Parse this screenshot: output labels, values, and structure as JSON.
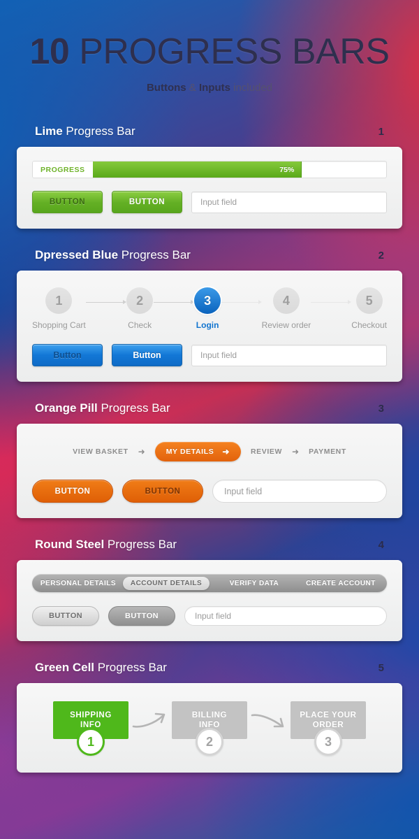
{
  "hero": {
    "title_number": "10",
    "title_rest": " PROGRESS BARS",
    "sub_bold1": "Buttons",
    "sub_amp": " & ",
    "sub_bold2": "Inputs",
    "sub_tail": " included"
  },
  "colors": {
    "lime": "#64b025",
    "blue": "#1277d6",
    "orange": "#e2620c",
    "steel": "#9a9a9a",
    "green": "#4fb81b",
    "card_bg": "#f0f0f0",
    "heading": "#ffffff",
    "number": "#2b2b4a"
  },
  "common": {
    "input_placeholder": "Input field"
  },
  "sections": [
    {
      "name_bold": "Lime",
      "name_rest": " Progress Bar",
      "number": "1",
      "progress": {
        "label": "PROGRESS",
        "value_label": "75%",
        "percent": 75
      },
      "buttons": [
        {
          "label": "BUTTON",
          "style": "dark"
        },
        {
          "label": "BUTTON",
          "style": "light"
        }
      ]
    },
    {
      "name_bold": "Dpressed Blue",
      "name_rest": " Progress Bar",
      "number": "2",
      "steps": [
        {
          "num": "1",
          "label": "Shopping Cart",
          "active": false
        },
        {
          "num": "2",
          "label": "Check",
          "active": false
        },
        {
          "num": "3",
          "label": "Login",
          "active": true
        },
        {
          "num": "4",
          "label": "Review order",
          "active": false
        },
        {
          "num": "5",
          "label": "Checkout",
          "active": false
        }
      ],
      "buttons": [
        {
          "label": "Button",
          "style": "dark"
        },
        {
          "label": "Button",
          "style": "light"
        }
      ]
    },
    {
      "name_bold": "Orange Pill",
      "name_rest": " Progress Bar",
      "number": "3",
      "steps": [
        {
          "label": "VIEW BASKET",
          "active": false
        },
        {
          "label": "MY DETAILS",
          "active": true
        },
        {
          "label": "REVIEW",
          "active": false
        },
        {
          "label": "PAYMENT",
          "active": false
        }
      ],
      "arrow_glyph": "➜",
      "buttons": [
        {
          "label": "BUTTON",
          "style": "light"
        },
        {
          "label": "BUTTON",
          "style": "dark"
        }
      ]
    },
    {
      "name_bold": "Round Steel",
      "name_rest": " Progress Bar",
      "number": "4",
      "steps": [
        {
          "label": "PERSONAL DETAILS",
          "active": false
        },
        {
          "label": "ACCOUNT DETAILS",
          "active": true
        },
        {
          "label": "VERIFY DATA",
          "active": false
        },
        {
          "label": "CREATE ACCOUNT",
          "active": false
        }
      ],
      "buttons": [
        {
          "label": "BUTTON",
          "style": "dark"
        },
        {
          "label": "BUTTON",
          "style": "light"
        }
      ]
    },
    {
      "name_bold": "Green Cell",
      "name_rest": " Progress Bar",
      "number": "5",
      "cells": [
        {
          "line1": "SHIPPING",
          "line2": "INFO",
          "badge": "1",
          "active": true
        },
        {
          "line1": "BILLING",
          "line2": "INFO",
          "badge": "2",
          "active": false
        },
        {
          "line1": "PLACE YOUR",
          "line2": "ORDER",
          "badge": "3",
          "active": false
        }
      ]
    }
  ]
}
